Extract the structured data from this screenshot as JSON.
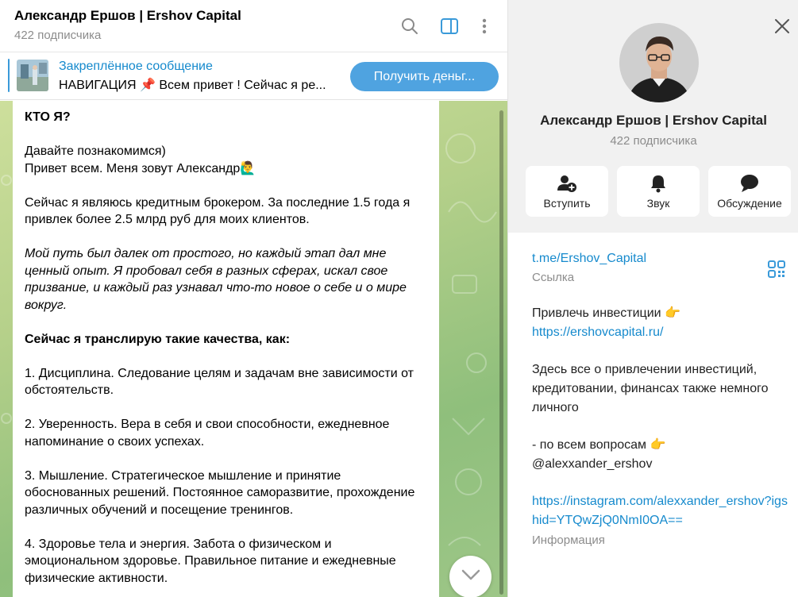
{
  "chat": {
    "title": "Александр Ершов | Ershov Capital",
    "subscribers": "422 подписчика",
    "pinned": {
      "title": "Закреплённое сообщение",
      "text": "НАВИГАЦИЯ 📌  Всем привет ! Сейчас я ре...",
      "button": "Получить деньг..."
    },
    "message": {
      "heading": "КТО Я?",
      "intro_1": "Давайте познакомимся)",
      "intro_2": "Привет всем. Меня зовут Александр🙋‍♂️",
      "p1": "Сейчас я являюсь кредитным брокером. За последние 1.5 года я привлек более 2.5 млрд руб для моих клиентов.",
      "p2": "Мой путь был далек от простого, но каждый этап дал мне ценный опыт. Я пробовал себя в разных сферах, искал свое призвание, и каждый раз узнавал что-то новое о себе и о мире вокруг.",
      "qualities_heading": "Сейчас я транслирую такие качества, как:",
      "q1": "1. Дисциплина. Следование целям и задачам вне зависимости от обстоятельств.",
      "q2": "2. Уверенность. Вера в себя и свои способности, ежедневное напоминание о своих успехах.",
      "q3": "3. Мышление. Стратегическое мышление и принятие обоснованных решений. Постоянное саморазвитие, прохождение различных обучений и посещение  тренингов.",
      "q4": "4. Здоровье тела и энергия. Забота о физическом и эмоциональном здоровье. Правильное питание и ежедневные физические активности."
    }
  },
  "profile": {
    "name": "Александр Ершов | Ershov Capital",
    "subscribers": "422 подписчика",
    "actions": [
      {
        "label": "Вступить",
        "icon": "add-user-icon"
      },
      {
        "label": "Звук",
        "icon": "bell-icon"
      },
      {
        "label": "Обсуждение",
        "icon": "chat-bubble-icon"
      }
    ],
    "link": "t.me/Ershov_Capital",
    "link_label": "Ссылка",
    "bio": {
      "line1": "Привлечь инвестиции 👉",
      "line2": "https://ershovcapital.ru/",
      "line3": "Здесь все о привлечении инвестиций, кредитовании, финансах также немного личного",
      "line4": "- по всем вопросам 👉",
      "line5": "@alexxander_ershov",
      "line6": "https://instagram.com/alexxander_ershov?igshid=YTQwZjQ0NmI0OA=="
    },
    "info_label": "Информация"
  },
  "colors": {
    "accent": "#168acd",
    "button": "#4fa3e0",
    "muted": "#8c8c8c"
  }
}
